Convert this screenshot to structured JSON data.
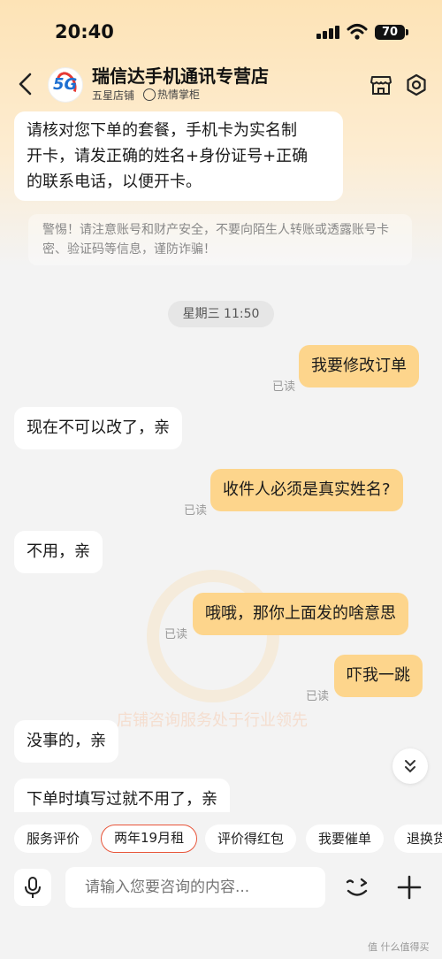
{
  "status": {
    "time": "20:40",
    "battery": "70"
  },
  "store": {
    "name": "瑞信达手机通讯专营店",
    "logo_text": "5G",
    "rating": "五星店铺",
    "badge": "热情掌柜"
  },
  "notice": "警惕！请注意账号和财产安全，不要向陌生人转账或透露账号卡密、验证码等信息，谨防诈骗！",
  "timestamp": "星期三 11:50",
  "messages": {
    "m0_line1": "请核对您下单的套餐，手机卡为实名制",
    "m0_line2": "开卡，请发正确的姓名+身份证号+正确",
    "m0_line3": "的联系电话，以便开卡。",
    "m1": "我要修改订单",
    "m2": "现在不可以改了，亲",
    "m3": "收件人必须是真实姓名?",
    "m4": "不用，亲",
    "m5": "哦哦，那你上面发的啥意思",
    "m6": "吓我一跳",
    "m7": "没事的，亲",
    "m8": "下单时填写过就不用了，亲"
  },
  "read_label": "已读",
  "watermark_text": "店铺咨询服务处于行业领先",
  "quick_actions": [
    "服务评价",
    "两年19月租",
    "评价得红包",
    "我要催单",
    "退换货"
  ],
  "input": {
    "placeholder": "请输入您要咨询的内容..."
  },
  "corner_mark": "值 什么值得买",
  "colors": {
    "accent": "#fdd58c",
    "chip_border": "#e8553a",
    "header_bg": "#fde3b6"
  }
}
